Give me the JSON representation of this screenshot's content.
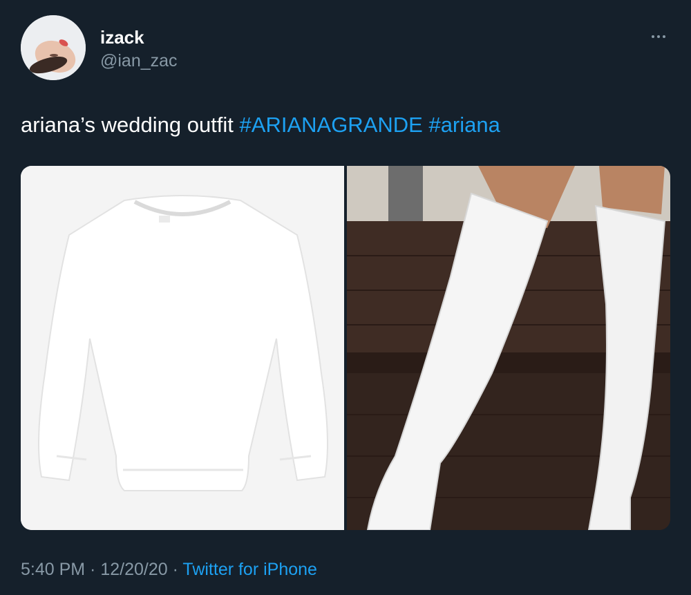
{
  "user": {
    "name": "izack",
    "handle": "@ian_zac"
  },
  "tweet": {
    "text": "ariana’s wedding outfit ",
    "hashtags": [
      "#ARIANAGRANDE",
      "#ariana"
    ],
    "time": "5:40 PM",
    "separator": " · ",
    "date": "12/20/20",
    "source": "Twitter for iPhone"
  },
  "media": [
    {
      "subject": "white crewneck sweatshirt"
    },
    {
      "subject": "white thigh-high patent boots"
    }
  ],
  "colors": {
    "background": "#15202b",
    "text_primary": "#ffffff",
    "text_secondary": "#8899a6",
    "accent": "#1da1f2"
  },
  "icons": {
    "more": "more-horizontal-icon"
  }
}
